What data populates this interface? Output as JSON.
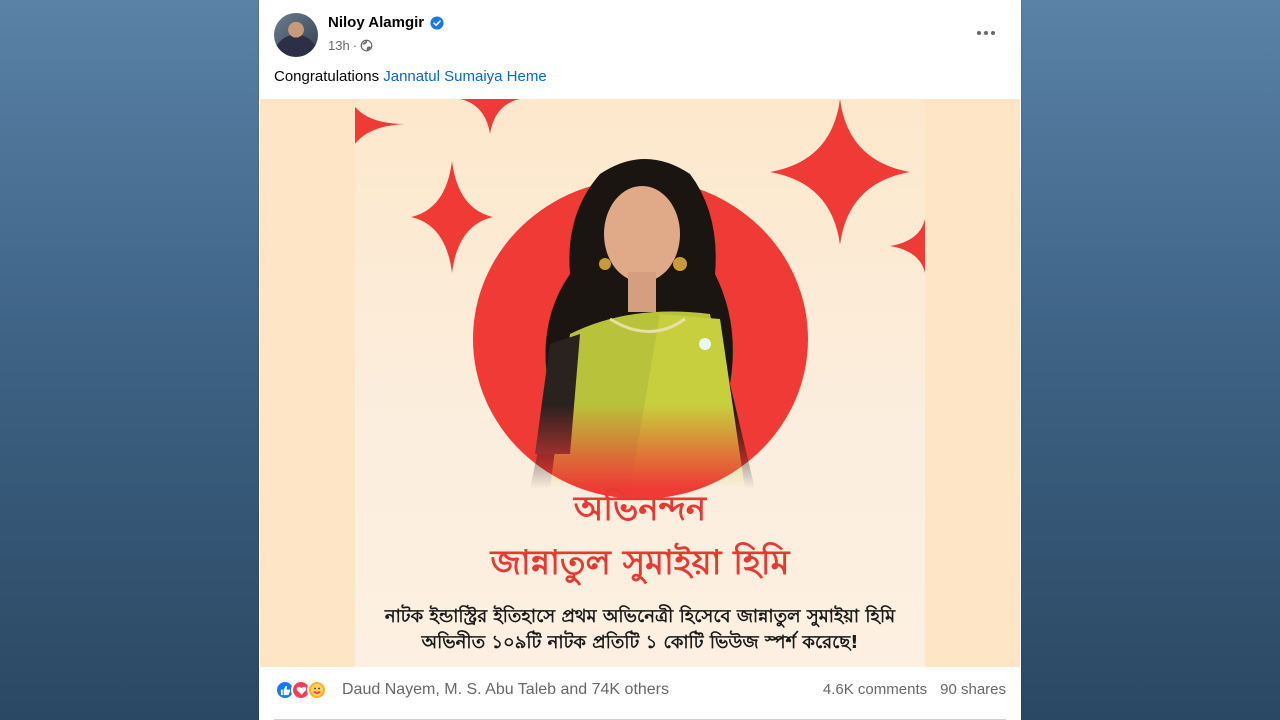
{
  "post": {
    "author": "Niloy Alamgir",
    "time": "13h",
    "separator": "·",
    "caption_prefix": "Congratulations",
    "caption_mention": "Jannatul Sumaiya Heme"
  },
  "poster": {
    "title": "অভিনন্দন",
    "name": "জান্নাতুল সুমাইয়া হিমি",
    "line1": "নাটক ইন্ডাস্ট্রির ইতিহাসে প্রথম অভিনেত্রী হিসেবে জান্নাতুল সুমাইয়া হিমি",
    "line2": "অভিনীত ১০৯টি নাটক প্রতিটি ১ কোটি ভিউজ স্পর্শ করেছে!"
  },
  "footer": {
    "reactions_text": "Daud Nayem, M. S. Abu Taleb and 74K others",
    "comments": "4.6K comments",
    "shares": "90 shares"
  },
  "icons": {
    "verified": "verified-badge-icon",
    "privacy": "globe-icon",
    "more": "more-options-icon",
    "reactions": [
      "like-icon",
      "love-icon",
      "care-icon"
    ]
  },
  "colors": {
    "accent": "#0a66c2",
    "poster_red": "#e53a32",
    "sun_red": "#ef3a35",
    "poster_bg": "#fde5c6"
  }
}
